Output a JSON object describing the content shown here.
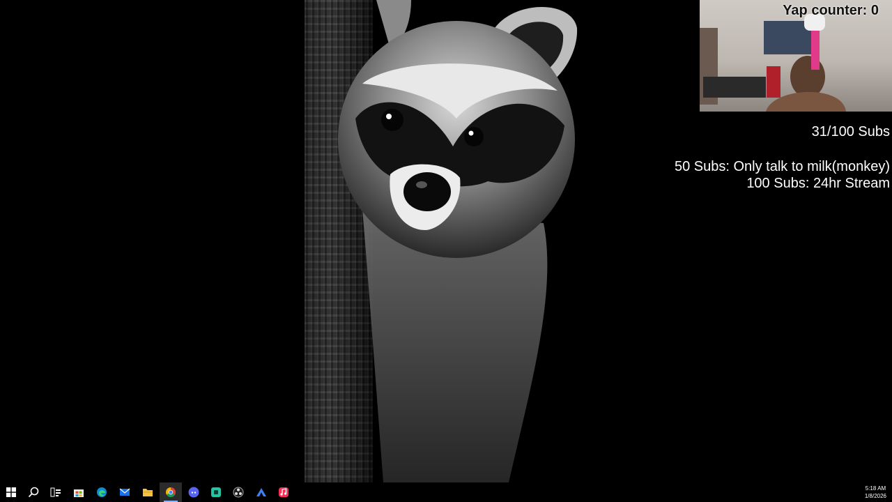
{
  "overlay": {
    "yap_counter": "Yap counter: 0",
    "subs_progress": "31/100 Subs",
    "goal_50": "50 Subs: Only talk to milk(monkey)",
    "goal_100": "100 Subs: 24hr Stream"
  },
  "taskbar": {
    "items": [
      {
        "name": "start-button",
        "icon": "windows-logo-icon"
      },
      {
        "name": "search-button",
        "icon": "search-icon"
      },
      {
        "name": "task-view-button",
        "icon": "task-view-icon"
      },
      {
        "name": "taskbar-item-store",
        "icon": "microsoft-store-icon"
      },
      {
        "name": "taskbar-item-edge",
        "icon": "edge-icon"
      },
      {
        "name": "taskbar-item-mail",
        "icon": "mail-icon"
      },
      {
        "name": "taskbar-item-file-explorer",
        "icon": "folder-icon"
      },
      {
        "name": "taskbar-item-chrome",
        "icon": "chrome-icon",
        "active": true
      },
      {
        "name": "taskbar-item-discord",
        "icon": "discord-icon"
      },
      {
        "name": "taskbar-item-app-teal",
        "icon": "teal-app-icon"
      },
      {
        "name": "taskbar-item-obs",
        "icon": "obs-icon"
      },
      {
        "name": "taskbar-item-app-blue",
        "icon": "blue-app-icon"
      },
      {
        "name": "taskbar-item-music",
        "icon": "apple-music-icon"
      }
    ],
    "time": "5:18 AM",
    "date": "1/8/2026"
  },
  "colors": {
    "desktop_bg": "#000000",
    "accent": "#8ab4f8"
  }
}
